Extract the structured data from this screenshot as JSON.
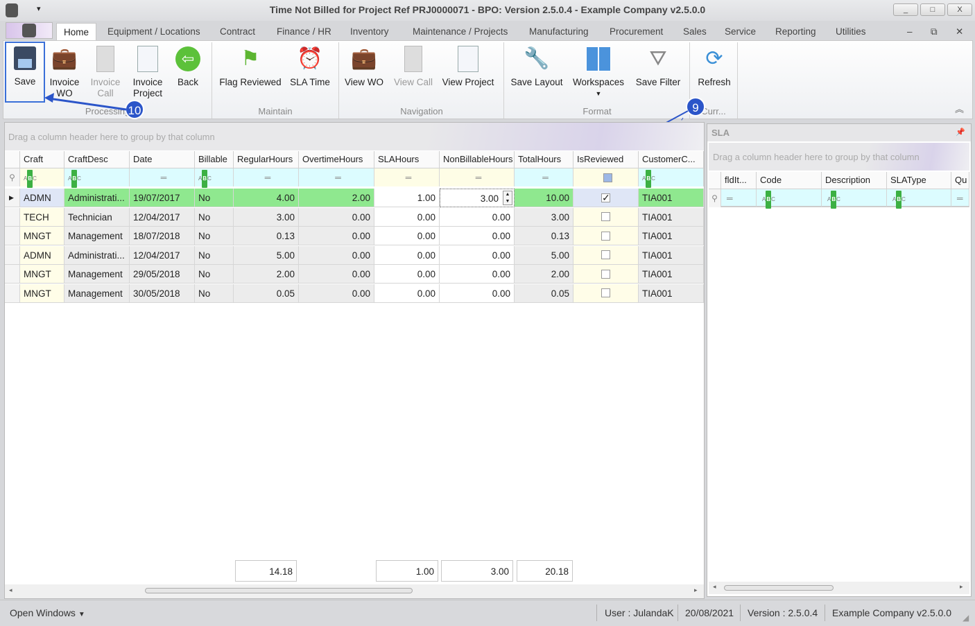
{
  "window": {
    "title": "Time Not Billed for Project Ref PRJ0000071 - BPO: Version 2.5.0.4 - Example Company v2.5.0.0",
    "min": "_",
    "max": "□",
    "close": "X"
  },
  "tabs": [
    "Home",
    "Equipment / Locations",
    "Contract",
    "Finance / HR",
    "Inventory",
    "Maintenance / Projects",
    "Manufacturing",
    "Procurement",
    "Sales",
    "Service",
    "Reporting",
    "Utilities"
  ],
  "ribbon": {
    "buttons": [
      {
        "label": "Save",
        "icon": "floppy-disk-icon"
      },
      {
        "label": "Invoice WO",
        "icon": "briefcase-document-icon"
      },
      {
        "label": "Invoice Call",
        "icon": "document-icon",
        "disabled": true
      },
      {
        "label": "Invoice Project",
        "icon": "document-add-icon"
      },
      {
        "label": "Back",
        "icon": "back-arrow-icon"
      },
      {
        "label": "Flag Reviewed",
        "icon": "flag-icon"
      },
      {
        "label": "SLA Time",
        "icon": "calendar-clock-icon"
      },
      {
        "label": "View WO",
        "icon": "briefcase-document-icon"
      },
      {
        "label": "View Call",
        "icon": "document-icon",
        "disabled": true
      },
      {
        "label": "View Project",
        "icon": "document-add-icon"
      },
      {
        "label": "Save Layout",
        "icon": "layout-wrench-icon"
      },
      {
        "label": "Workspaces",
        "icon": "grid-icon"
      },
      {
        "label": "Save Filter",
        "icon": "funnel-icon"
      },
      {
        "label": "Refresh",
        "icon": "refresh-icon"
      }
    ],
    "groups": [
      "Processing",
      "Maintain",
      "Navigation",
      "Format",
      "Curr..."
    ]
  },
  "annotations": {
    "save": "10",
    "reviewed": "9"
  },
  "grid": {
    "group_hint": "Drag a column header here to group by that column",
    "columns": [
      "Craft",
      "CraftDesc",
      "Date",
      "Billable",
      "RegularHours",
      "OvertimeHours",
      "SLAHours",
      "NonBillableHours",
      "TotalHours",
      "IsReviewed",
      "CustomerC..."
    ],
    "rows": [
      [
        "ADMN",
        "Administrati...",
        "19/07/2017",
        "No",
        "4.00",
        "2.00",
        "1.00",
        "3.00",
        "10.00",
        true,
        "TIA001"
      ],
      [
        "TECH",
        "Technician",
        "12/04/2017",
        "No",
        "3.00",
        "0.00",
        "0.00",
        "0.00",
        "3.00",
        false,
        "TIA001"
      ],
      [
        "MNGT",
        "Management",
        "18/07/2018",
        "No",
        "0.13",
        "0.00",
        "0.00",
        "0.00",
        "0.13",
        false,
        "TIA001"
      ],
      [
        "ADMN",
        "Administrati...",
        "12/04/2017",
        "No",
        "5.00",
        "0.00",
        "0.00",
        "0.00",
        "5.00",
        false,
        "TIA001"
      ],
      [
        "MNGT",
        "Management",
        "29/05/2018",
        "No",
        "2.00",
        "0.00",
        "0.00",
        "0.00",
        "2.00",
        false,
        "TIA001"
      ],
      [
        "MNGT",
        "Management",
        "30/05/2018",
        "No",
        "0.05",
        "0.00",
        "0.00",
        "0.00",
        "0.05",
        false,
        "TIA001"
      ]
    ],
    "totals": {
      "RegularHours": "14.18",
      "SLAHours": "1.00",
      "NonBillableHours": "3.00",
      "TotalHours": "20.18"
    }
  },
  "sla": {
    "title": "SLA",
    "group_hint": "Drag a column header here to group by that column",
    "columns": [
      "fldIt...",
      "Code",
      "Description",
      "SLAType",
      "Qu"
    ]
  },
  "status": {
    "open_windows": "Open Windows",
    "user": "User : JulandaK",
    "date": "20/08/2021",
    "version": "Version : 2.5.0.4",
    "company": "Example Company v2.5.0.0"
  },
  "colors": {
    "selected_row": "#8fe88f",
    "annotation": "#2b55c9"
  }
}
